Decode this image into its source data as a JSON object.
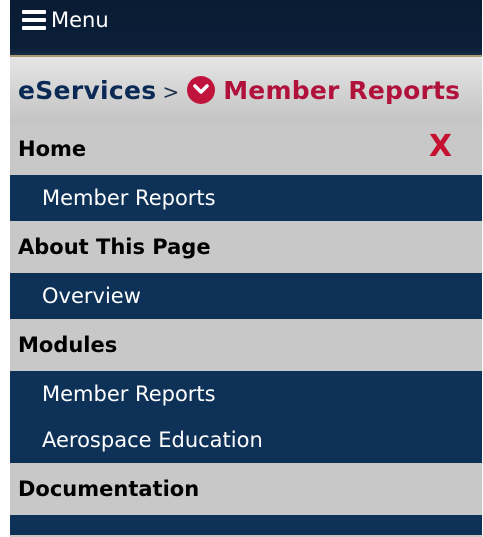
{
  "header": {
    "menu_label": "Menu"
  },
  "breadcrumb": {
    "root": "eServices",
    "separator": ">",
    "current": "Member Reports",
    "chevron_icon": "chevron-down-circle-icon"
  },
  "close_label": "X",
  "sections": [
    {
      "title": "Home",
      "items": [
        "Member Reports"
      ]
    },
    {
      "title": "About This Page",
      "items": [
        "Overview"
      ]
    },
    {
      "title": "Modules",
      "items": [
        "Member Reports",
        "Aerospace Education"
      ]
    },
    {
      "title": "Documentation",
      "items": []
    }
  ],
  "colors": {
    "navy": "#0e3158",
    "header_bg": "#0a1c33",
    "accent_red": "#c0143c",
    "panel_gray": "#c8c8c8"
  }
}
